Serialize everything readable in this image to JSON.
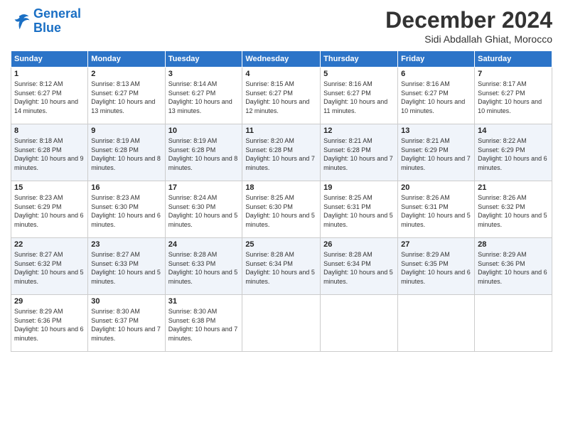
{
  "logo": {
    "line1": "General",
    "line2": "Blue"
  },
  "header": {
    "title": "December 2024",
    "subtitle": "Sidi Abdallah Ghiat, Morocco"
  },
  "days_of_week": [
    "Sunday",
    "Monday",
    "Tuesday",
    "Wednesday",
    "Thursday",
    "Friday",
    "Saturday"
  ],
  "weeks": [
    [
      {
        "day": 1,
        "info": "Sunrise: 8:12 AM\nSunset: 6:27 PM\nDaylight: 10 hours and 14 minutes."
      },
      {
        "day": 2,
        "info": "Sunrise: 8:13 AM\nSunset: 6:27 PM\nDaylight: 10 hours and 13 minutes."
      },
      {
        "day": 3,
        "info": "Sunrise: 8:14 AM\nSunset: 6:27 PM\nDaylight: 10 hours and 13 minutes."
      },
      {
        "day": 4,
        "info": "Sunrise: 8:15 AM\nSunset: 6:27 PM\nDaylight: 10 hours and 12 minutes."
      },
      {
        "day": 5,
        "info": "Sunrise: 8:16 AM\nSunset: 6:27 PM\nDaylight: 10 hours and 11 minutes."
      },
      {
        "day": 6,
        "info": "Sunrise: 8:16 AM\nSunset: 6:27 PM\nDaylight: 10 hours and 10 minutes."
      },
      {
        "day": 7,
        "info": "Sunrise: 8:17 AM\nSunset: 6:27 PM\nDaylight: 10 hours and 10 minutes."
      }
    ],
    [
      {
        "day": 8,
        "info": "Sunrise: 8:18 AM\nSunset: 6:28 PM\nDaylight: 10 hours and 9 minutes."
      },
      {
        "day": 9,
        "info": "Sunrise: 8:19 AM\nSunset: 6:28 PM\nDaylight: 10 hours and 8 minutes."
      },
      {
        "day": 10,
        "info": "Sunrise: 8:19 AM\nSunset: 6:28 PM\nDaylight: 10 hours and 8 minutes."
      },
      {
        "day": 11,
        "info": "Sunrise: 8:20 AM\nSunset: 6:28 PM\nDaylight: 10 hours and 7 minutes."
      },
      {
        "day": 12,
        "info": "Sunrise: 8:21 AM\nSunset: 6:28 PM\nDaylight: 10 hours and 7 minutes."
      },
      {
        "day": 13,
        "info": "Sunrise: 8:21 AM\nSunset: 6:29 PM\nDaylight: 10 hours and 7 minutes."
      },
      {
        "day": 14,
        "info": "Sunrise: 8:22 AM\nSunset: 6:29 PM\nDaylight: 10 hours and 6 minutes."
      }
    ],
    [
      {
        "day": 15,
        "info": "Sunrise: 8:23 AM\nSunset: 6:29 PM\nDaylight: 10 hours and 6 minutes."
      },
      {
        "day": 16,
        "info": "Sunrise: 8:23 AM\nSunset: 6:30 PM\nDaylight: 10 hours and 6 minutes."
      },
      {
        "day": 17,
        "info": "Sunrise: 8:24 AM\nSunset: 6:30 PM\nDaylight: 10 hours and 5 minutes."
      },
      {
        "day": 18,
        "info": "Sunrise: 8:25 AM\nSunset: 6:30 PM\nDaylight: 10 hours and 5 minutes."
      },
      {
        "day": 19,
        "info": "Sunrise: 8:25 AM\nSunset: 6:31 PM\nDaylight: 10 hours and 5 minutes."
      },
      {
        "day": 20,
        "info": "Sunrise: 8:26 AM\nSunset: 6:31 PM\nDaylight: 10 hours and 5 minutes."
      },
      {
        "day": 21,
        "info": "Sunrise: 8:26 AM\nSunset: 6:32 PM\nDaylight: 10 hours and 5 minutes."
      }
    ],
    [
      {
        "day": 22,
        "info": "Sunrise: 8:27 AM\nSunset: 6:32 PM\nDaylight: 10 hours and 5 minutes."
      },
      {
        "day": 23,
        "info": "Sunrise: 8:27 AM\nSunset: 6:33 PM\nDaylight: 10 hours and 5 minutes."
      },
      {
        "day": 24,
        "info": "Sunrise: 8:28 AM\nSunset: 6:33 PM\nDaylight: 10 hours and 5 minutes."
      },
      {
        "day": 25,
        "info": "Sunrise: 8:28 AM\nSunset: 6:34 PM\nDaylight: 10 hours and 5 minutes."
      },
      {
        "day": 26,
        "info": "Sunrise: 8:28 AM\nSunset: 6:34 PM\nDaylight: 10 hours and 5 minutes."
      },
      {
        "day": 27,
        "info": "Sunrise: 8:29 AM\nSunset: 6:35 PM\nDaylight: 10 hours and 6 minutes."
      },
      {
        "day": 28,
        "info": "Sunrise: 8:29 AM\nSunset: 6:36 PM\nDaylight: 10 hours and 6 minutes."
      }
    ],
    [
      {
        "day": 29,
        "info": "Sunrise: 8:29 AM\nSunset: 6:36 PM\nDaylight: 10 hours and 6 minutes."
      },
      {
        "day": 30,
        "info": "Sunrise: 8:30 AM\nSunset: 6:37 PM\nDaylight: 10 hours and 7 minutes."
      },
      {
        "day": 31,
        "info": "Sunrise: 8:30 AM\nSunset: 6:38 PM\nDaylight: 10 hours and 7 minutes."
      },
      null,
      null,
      null,
      null
    ]
  ]
}
